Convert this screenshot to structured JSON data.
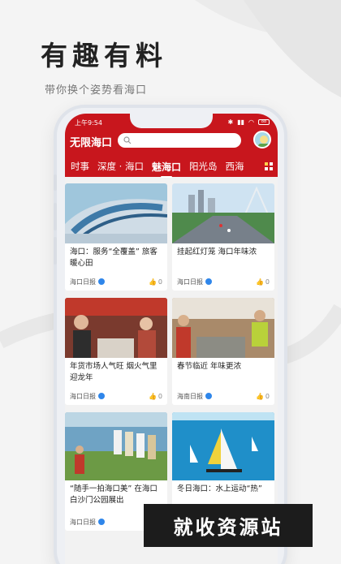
{
  "promo": {
    "headline": "有趣有料",
    "subline": "带你换个姿势看海口"
  },
  "status_bar": {
    "time": "上午9:54",
    "battery": "88"
  },
  "app": {
    "title": "无限海口",
    "search_placeholder": ""
  },
  "tabs": [
    {
      "label": "时事",
      "active": false
    },
    {
      "label": "深度 · 海口",
      "active": false
    },
    {
      "label": "魅海口",
      "active": true
    },
    {
      "label": "阳光岛",
      "active": false
    },
    {
      "label": "西海",
      "active": false
    }
  ],
  "cards": [
    {
      "title": "海口：服务“全覆盖” 旅客暖心田",
      "source": "海口日报",
      "likes": "0"
    },
    {
      "title": "挂起红灯笼 海口年味浓",
      "source": "海口日报",
      "likes": "0"
    },
    {
      "title": "年货市场人气旺 烟火气里迎龙年",
      "source": "海口日报",
      "likes": "0"
    },
    {
      "title": "春节临近 年味更浓",
      "source": "海南日报",
      "likes": "0"
    },
    {
      "title": "“随手一拍海口美” 在海口白沙门公园展出",
      "source": "海口日报",
      "likes": "0"
    },
    {
      "title": "冬日海口：水上运动“热”",
      "source": "",
      "likes": ""
    }
  ],
  "watermark": "就收资源站",
  "colors": {
    "brand_red": "#c8161d",
    "verify_blue": "#2f86ea"
  }
}
